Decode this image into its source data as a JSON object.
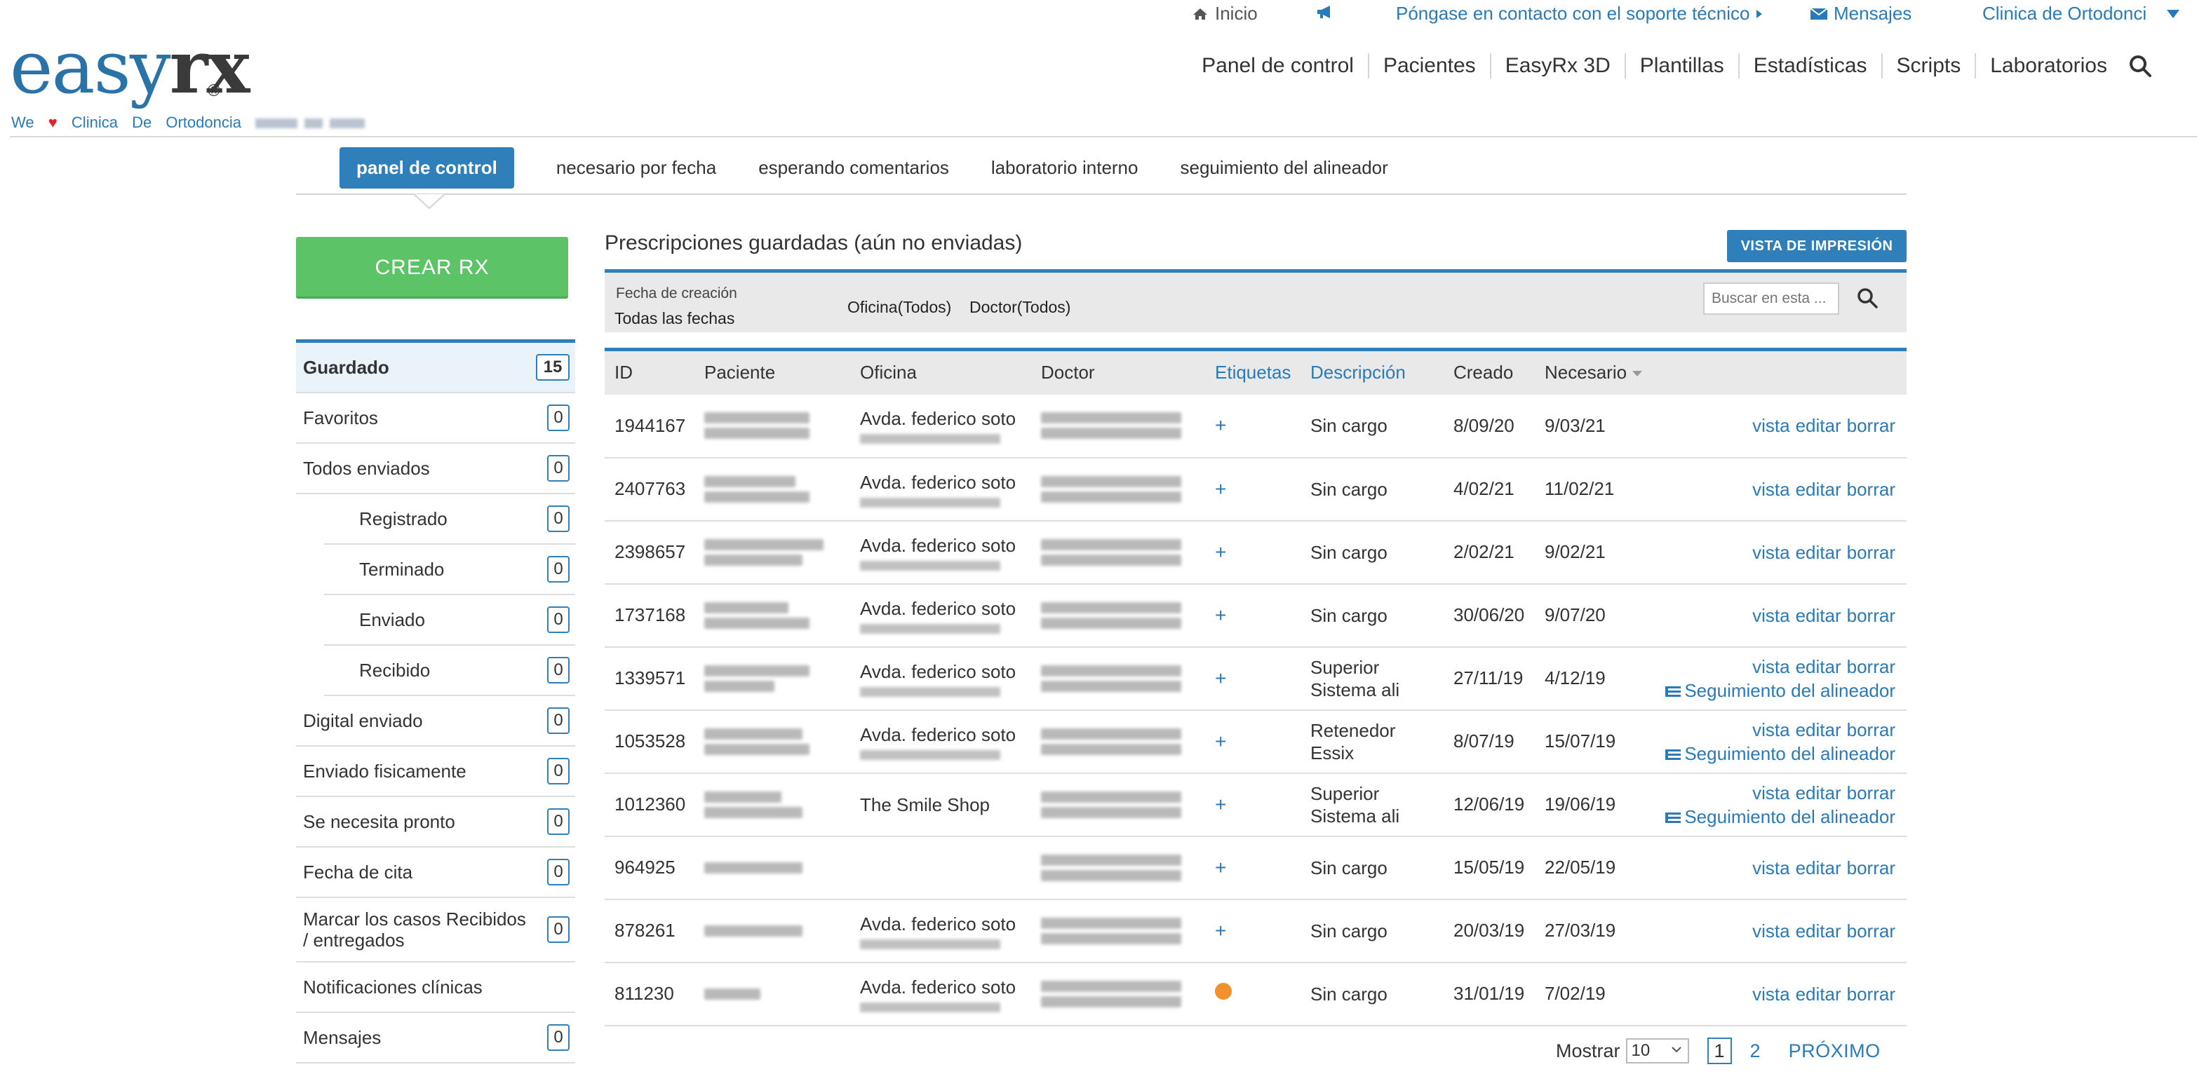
{
  "topbar": {
    "home": "Inicio",
    "support": "Póngase en contacto con el soporte técnico",
    "messages": "Mensajes",
    "clinic": "Clinica de Ortodonci"
  },
  "logo": {
    "easy": "easy",
    "rx": "rx",
    "reg": "®"
  },
  "tagline": {
    "we": "We",
    "w1": "Clinica",
    "w2": "De",
    "w3": "Ortodoncia"
  },
  "nav": [
    "Panel de control",
    "Pacientes",
    "EasyRx 3D",
    "Plantillas",
    "Estadísticas",
    "Scripts",
    "Laboratorios"
  ],
  "subtabs": [
    "panel de control",
    "necesario por fecha",
    "esperando comentarios",
    "laboratorio interno",
    "seguimiento del alineador"
  ],
  "create_button": "CREAR RX",
  "sidebar": [
    {
      "label": "Guardado",
      "count": "15"
    },
    {
      "label": "Favoritos",
      "count": "0"
    },
    {
      "label": "Todos enviados",
      "count": "0"
    },
    {
      "label": "Registrado",
      "count": "0"
    },
    {
      "label": "Terminado",
      "count": "0"
    },
    {
      "label": "Enviado",
      "count": "0"
    },
    {
      "label": "Recibido",
      "count": "0"
    },
    {
      "label": "Digital enviado",
      "count": "0"
    },
    {
      "label": "Enviado fisicamente",
      "count": "0"
    },
    {
      "label": "Se necesita pronto",
      "count": "0"
    },
    {
      "label": "Fecha de cita",
      "count": "0"
    },
    {
      "label": "Marcar los casos Recibidos / entregados",
      "count": "0"
    },
    {
      "label": "Notificaciones clínicas",
      "count": ""
    },
    {
      "label": "Mensajes",
      "count": "0"
    }
  ],
  "content": {
    "title": "Prescripciones guardadas (aún no enviadas)",
    "print_button": "VISTA DE IMPRESIÓN"
  },
  "filters": {
    "date_label": "Fecha de creación",
    "date_value": "Todas las fechas",
    "office": "Oficina(Todos)",
    "doctor": "Doctor(Todos)",
    "search_placeholder": "Buscar en esta ..."
  },
  "table": {
    "headers": [
      "ID",
      "Paciente",
      "Oficina",
      "Doctor",
      "Etiquetas",
      "Descripción",
      "Creado",
      "Necesario"
    ],
    "action_labels": {
      "view": "vista",
      "edit": "editar",
      "delete": "borrar",
      "aligner": "Seguimiento del alineador"
    },
    "rows": [
      {
        "id": "1944167",
        "office": "Avda. federico soto",
        "desc1": "Sin cargo",
        "desc2": "",
        "created": "8/09/20",
        "needed": "9/03/21",
        "tag": "+",
        "aligner": false
      },
      {
        "id": "2407763",
        "office": "Avda. federico soto",
        "desc1": "Sin cargo",
        "desc2": "",
        "created": "4/02/21",
        "needed": "11/02/21",
        "tag": "+",
        "aligner": false
      },
      {
        "id": "2398657",
        "office": "Avda. federico soto",
        "desc1": "Sin cargo",
        "desc2": "",
        "created": "2/02/21",
        "needed": "9/02/21",
        "tag": "+",
        "aligner": false
      },
      {
        "id": "1737168",
        "office": "Avda. federico soto",
        "desc1": "Sin cargo",
        "desc2": "",
        "created": "30/06/20",
        "needed": "9/07/20",
        "tag": "+",
        "aligner": false
      },
      {
        "id": "1339571",
        "office": "Avda. federico soto",
        "desc1": "Superior",
        "desc2": "Sistema ali",
        "created": "27/11/19",
        "needed": "4/12/19",
        "tag": "+",
        "aligner": true
      },
      {
        "id": "1053528",
        "office": "Avda. federico soto",
        "desc1": "Retenedor",
        "desc2": "Essix",
        "created": "8/07/19",
        "needed": "15/07/19",
        "tag": "+",
        "aligner": true
      },
      {
        "id": "1012360",
        "office": "The Smile Shop",
        "desc1": "Superior",
        "desc2": "Sistema ali",
        "created": "12/06/19",
        "needed": "19/06/19",
        "tag": "+",
        "aligner": true
      },
      {
        "id": "964925",
        "office": "",
        "desc1": "Sin cargo",
        "desc2": "",
        "created": "15/05/19",
        "needed": "22/05/19",
        "tag": "+",
        "aligner": false
      },
      {
        "id": "878261",
        "office": "Avda. federico soto",
        "desc1": "Sin cargo",
        "desc2": "",
        "created": "20/03/19",
        "needed": "27/03/19",
        "tag": "+",
        "aligner": false
      },
      {
        "id": "811230",
        "office": "Avda. federico soto",
        "desc1": "Sin cargo",
        "desc2": "",
        "created": "31/01/19",
        "needed": "7/02/19",
        "tag": "dot",
        "aligner": false
      }
    ]
  },
  "pagination": {
    "show_label": "Mostrar",
    "page_size": "10",
    "pages": [
      "1",
      "2"
    ],
    "next": "PRÓXIMO"
  },
  "colors": {
    "accent": "#2e7fba",
    "create": "#5cc466",
    "tag_dot": "#f0912c",
    "heart": "#e0242a"
  }
}
